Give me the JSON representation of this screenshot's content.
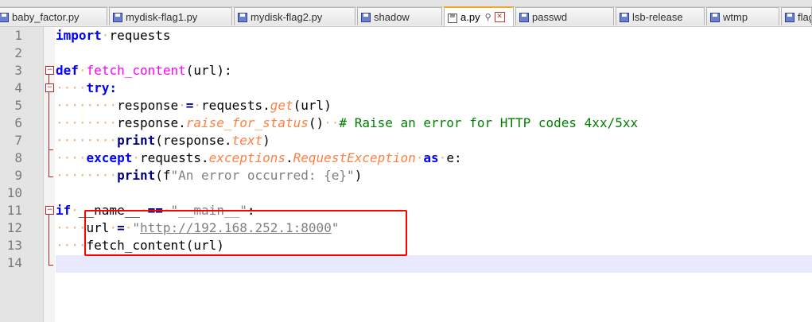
{
  "tabs": [
    {
      "label": "baby_factor.py",
      "active": false
    },
    {
      "label": "mydisk-flag1.py",
      "active": false
    },
    {
      "label": "mydisk-flag2.py",
      "active": false
    },
    {
      "label": "shadow",
      "active": false
    },
    {
      "label": "a.py",
      "active": true
    },
    {
      "label": "passwd",
      "active": false
    },
    {
      "label": "lsb-release",
      "active": false
    },
    {
      "label": "wtmp",
      "active": false
    },
    {
      "label": "flag",
      "active": false
    }
  ],
  "line_numbers": [
    "1",
    "2",
    "3",
    "4",
    "5",
    "6",
    "7",
    "8",
    "9",
    "10",
    "11",
    "12",
    "13",
    "14"
  ],
  "code": {
    "l1_import": "import",
    "l1_mod": "requests",
    "l3_def": "def",
    "l3_fn": "fetch_content",
    "l3_rest": "(url):",
    "l4_try": "try:",
    "l5_resp": "response",
    "l5_eq": "=",
    "l5_req": "requests.",
    "l5_get": "get",
    "l5_rest": "(url)",
    "l6_resp": "response.",
    "l6_method": "raise_for_status",
    "l6_paren": "()",
    "l6_comment": "# Raise an error for HTTP codes 4xx/5xx",
    "l7_print": "print",
    "l7_open": "(response.",
    "l7_text": "text",
    "l7_close": ")",
    "l8_except": "except",
    "l8_req": "requests.",
    "l8_exc": "exceptions",
    "l8_dot": ".",
    "l8_cls": "RequestException",
    "l8_as": "as",
    "l8_e": "e:",
    "l9_print": "print",
    "l9_open": "(f",
    "l9_str": "\"An error occurred: {e}\"",
    "l9_close": ")",
    "l11_if": "if",
    "l11_name": "__name__",
    "l11_eqeq": "==",
    "l11_main": "\"__main__\"",
    "l11_colon": ":",
    "l12_url": "url",
    "l12_eq": "=",
    "l12_q1": "\"",
    "l12_link": "http://192.168.252.1:8000",
    "l12_q2": "\"",
    "l13_call": "fetch_content(url)"
  },
  "colors": {
    "keyword": "#0000ff",
    "function_name": "#ff00ff",
    "attribute": "#ff8040",
    "comment": "#008000",
    "string": "#808080",
    "highlight_box": "#ff0000",
    "current_line": "#e8e8ff"
  },
  "icons": {
    "tab_file": "floppy-disk-icon",
    "tab_pin": "pin-icon",
    "tab_close": "close-icon",
    "fold": "fold-minus-icon"
  }
}
